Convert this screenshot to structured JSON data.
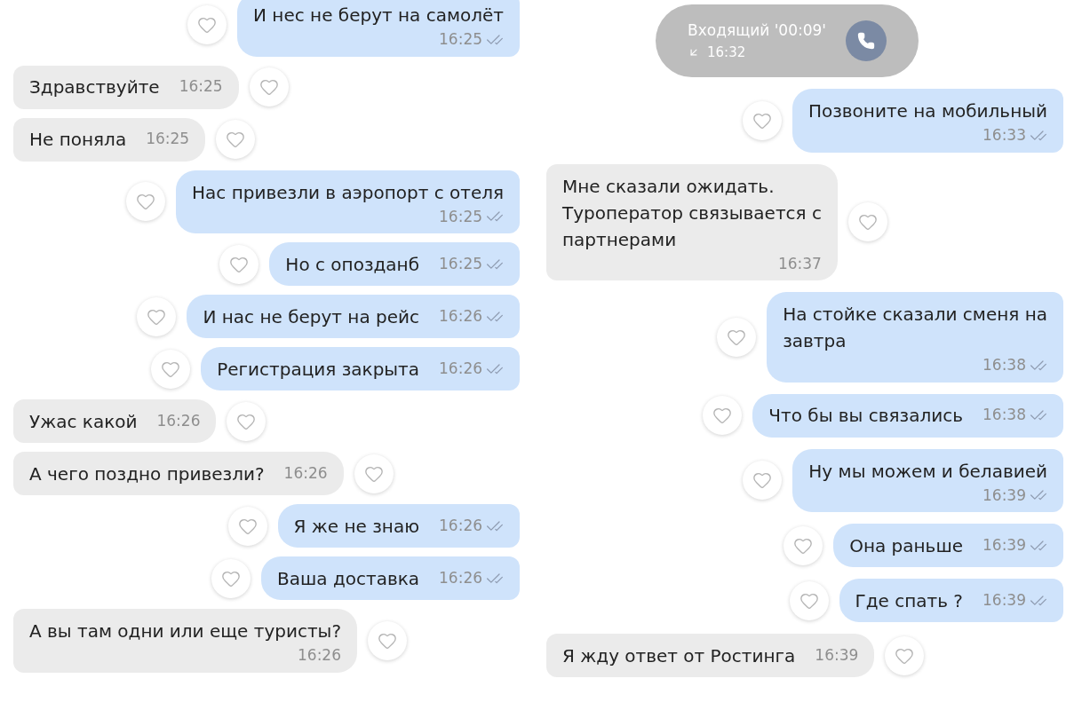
{
  "panels": [
    {
      "items": [
        {
          "kind": "outgoing",
          "stacked": true,
          "text": "И нес не берут на самолёт",
          "time": "16:25"
        },
        {
          "kind": "incoming",
          "stacked": false,
          "text": "Здравствуйте",
          "time": "16:25"
        },
        {
          "kind": "incoming",
          "stacked": false,
          "text": "Не поняла",
          "time": "16:25"
        },
        {
          "kind": "outgoing",
          "stacked": true,
          "text": "Нас привезли в аэропорт с отеля",
          "time": "16:25"
        },
        {
          "kind": "outgoing",
          "stacked": false,
          "text": "Но с опозданб",
          "time": "16:25"
        },
        {
          "kind": "outgoing",
          "stacked": false,
          "text": "И нас не берут на рейс",
          "time": "16:26"
        },
        {
          "kind": "outgoing",
          "stacked": false,
          "text": "Регистрация закрыта",
          "time": "16:26"
        },
        {
          "kind": "incoming",
          "stacked": false,
          "text": "Ужас какой",
          "time": "16:26"
        },
        {
          "kind": "incoming",
          "stacked": false,
          "text": "А чего поздно привезли?",
          "time": "16:26"
        },
        {
          "kind": "outgoing",
          "stacked": false,
          "text": "Я же не знаю",
          "time": "16:26"
        },
        {
          "kind": "outgoing",
          "stacked": false,
          "text": "Ваша доставка",
          "time": "16:26"
        },
        {
          "kind": "incoming",
          "stacked": true,
          "text": "А вы там одни или еще туристы?",
          "time": "16:26"
        }
      ]
    },
    {
      "items": [
        {
          "kind": "call",
          "text": "Входящий '00:09'",
          "time": "16:32"
        },
        {
          "kind": "outgoing",
          "stacked": true,
          "text": "Позвоните на мобильный",
          "time": "16:33"
        },
        {
          "kind": "incoming",
          "stacked": true,
          "text": "Мне сказали ожидать.\nТуроператор связывается с\nпартнерами",
          "time": "16:37"
        },
        {
          "kind": "outgoing",
          "stacked": true,
          "text": "На стойке сказали сменя на\nзавтра",
          "time": "16:38"
        },
        {
          "kind": "outgoing",
          "stacked": false,
          "text": "Что бы вы связались",
          "time": "16:38"
        },
        {
          "kind": "outgoing",
          "stacked": true,
          "text": "Ну мы можем и белавией",
          "time": "16:39"
        },
        {
          "kind": "outgoing",
          "stacked": false,
          "text": "Она раньше",
          "time": "16:39"
        },
        {
          "kind": "outgoing",
          "stacked": false,
          "text": "Где спать ?",
          "time": "16:39"
        },
        {
          "kind": "incoming",
          "stacked": false,
          "text": "Я жду ответ от Ростинга",
          "time": "16:39"
        }
      ]
    }
  ]
}
